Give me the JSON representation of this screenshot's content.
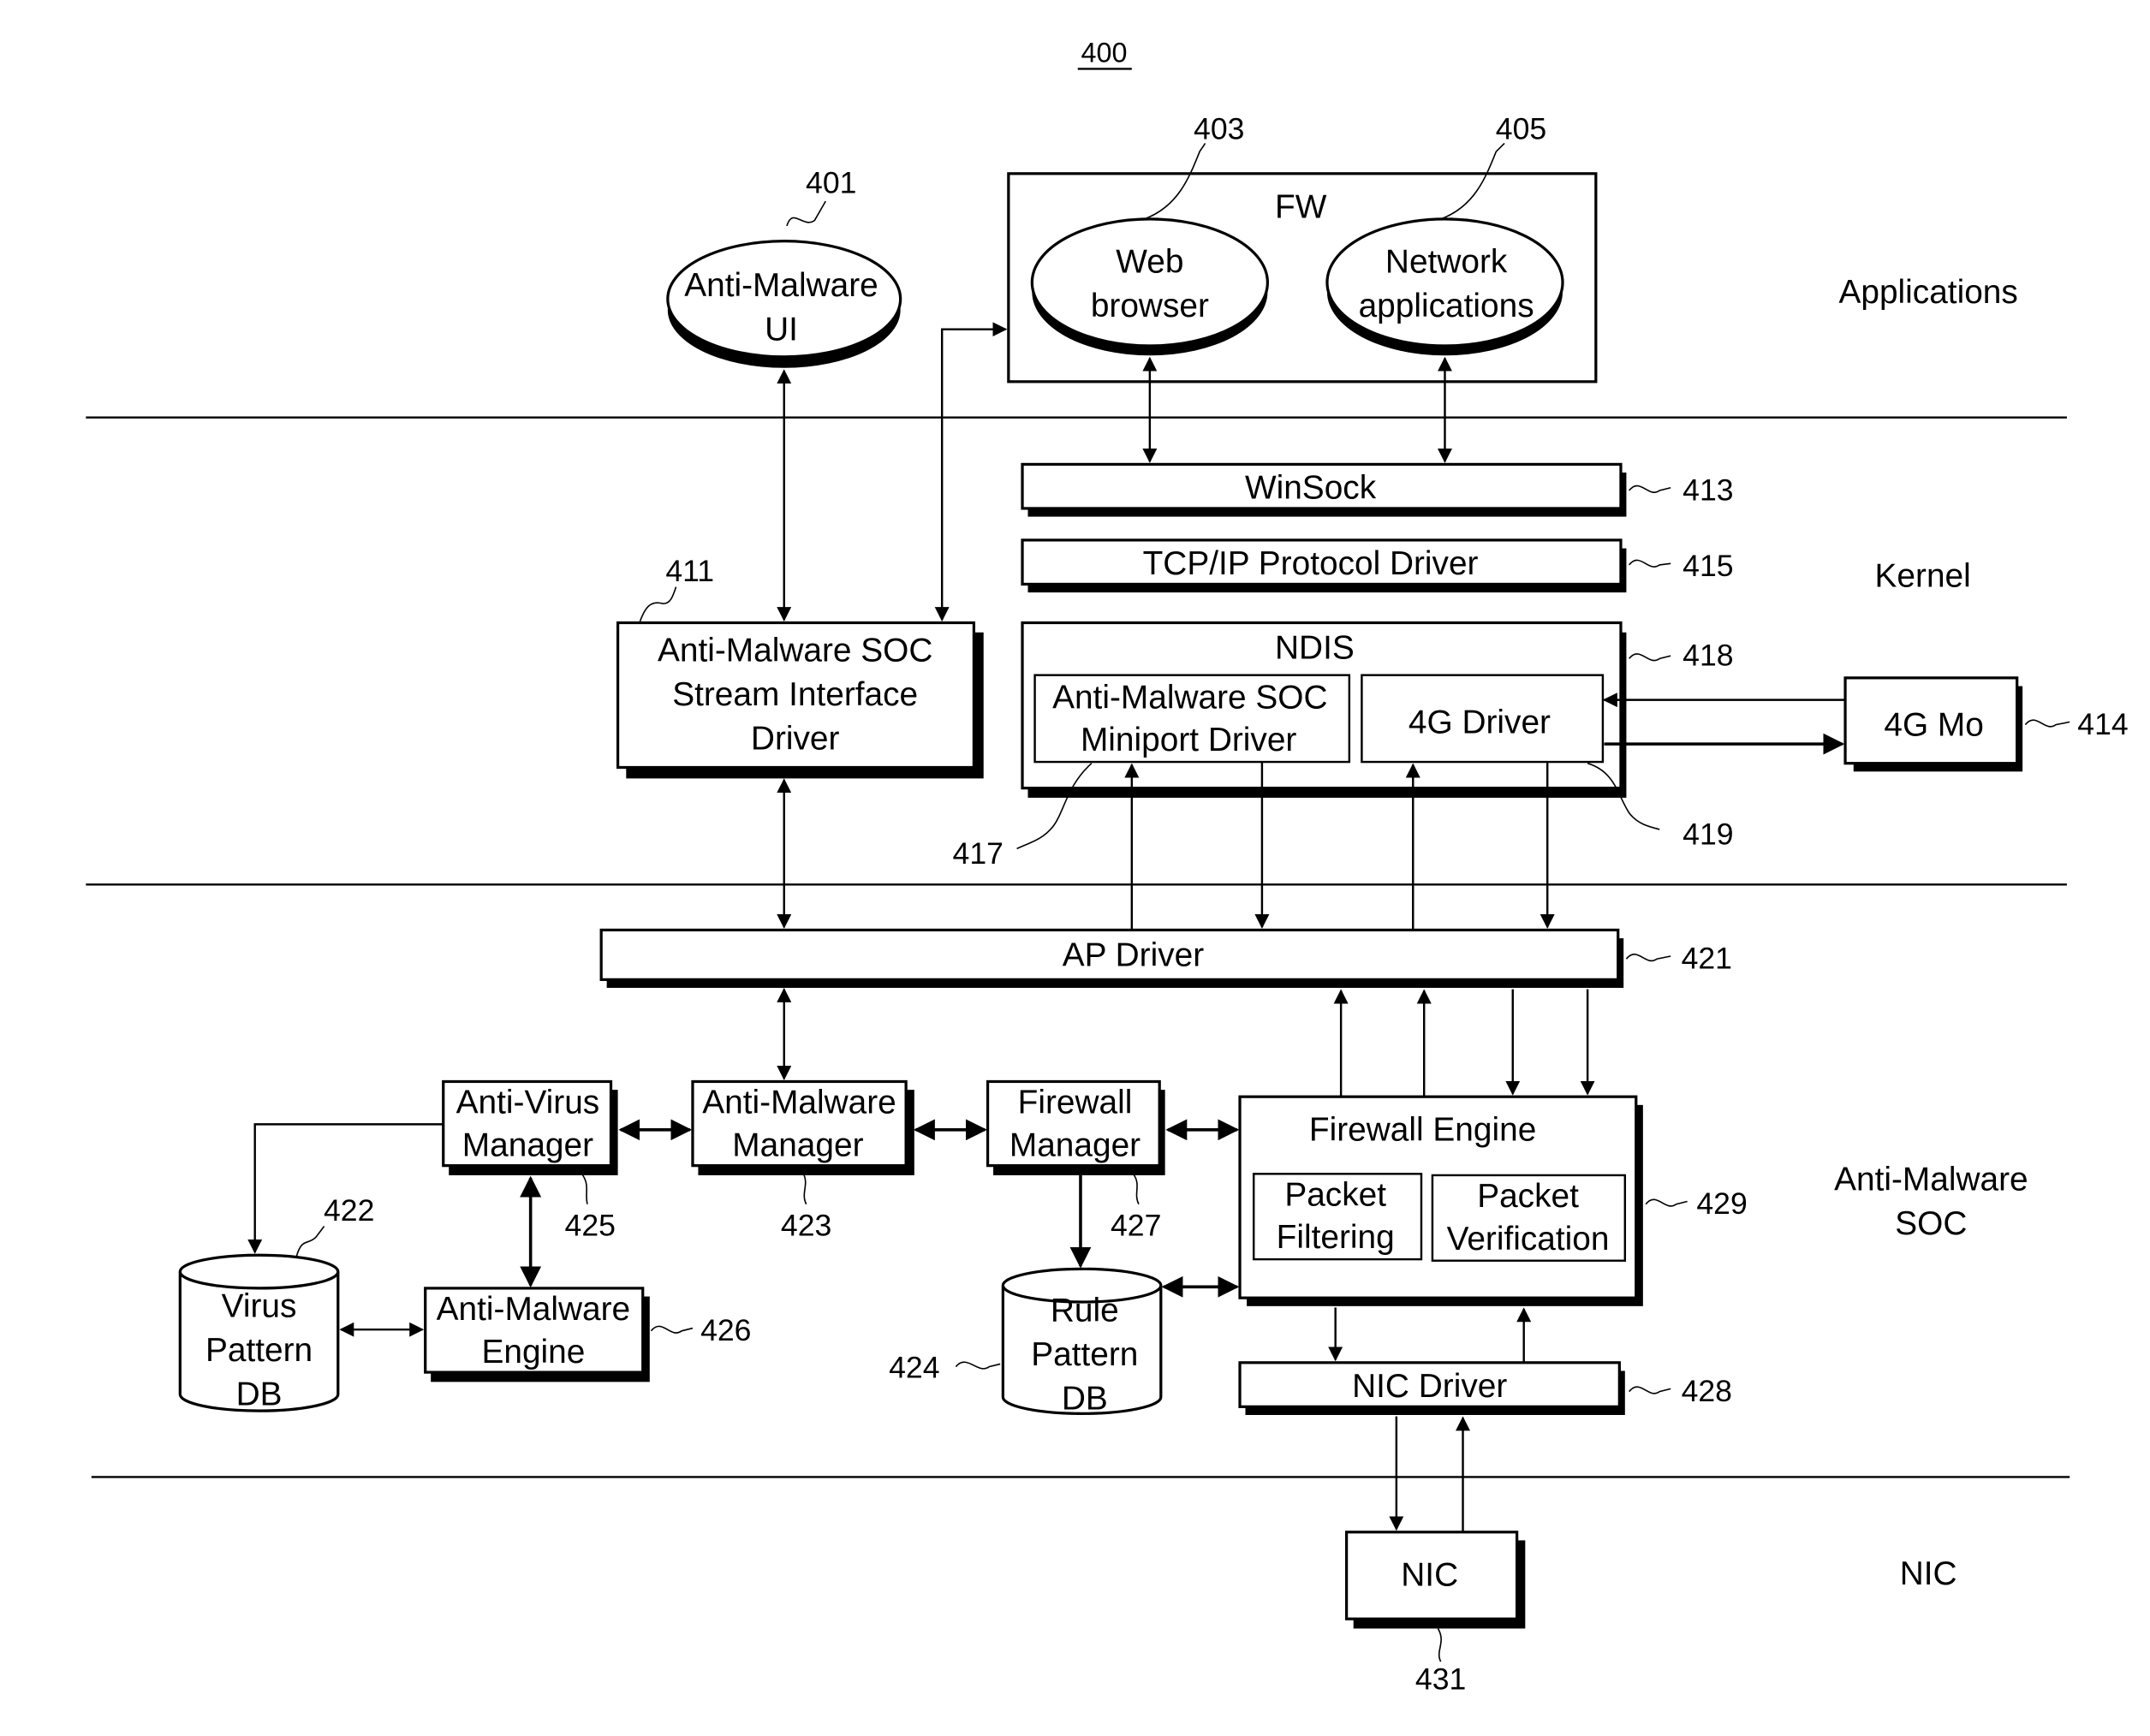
{
  "figure_number": "400",
  "layers": {
    "applications": "Applications",
    "kernel": "Kernel",
    "soc": [
      "Anti-Malware",
      "SOC"
    ],
    "nic": "NIC"
  },
  "components": {
    "anti_malware_ui": {
      "lines": [
        "Anti-Malware",
        "UI"
      ],
      "ref": "401"
    },
    "fw_group": {
      "title": "FW"
    },
    "web_browser": {
      "lines": [
        "Web",
        "browser"
      ],
      "ref": "403"
    },
    "network_apps": {
      "lines": [
        "Network",
        "applications"
      ],
      "ref": "405"
    },
    "stream_interface_driver": {
      "lines": [
        "Anti-Malware SOC",
        "Stream Interface",
        "Driver"
      ],
      "ref": "411"
    },
    "winsock": {
      "label": "WinSock",
      "ref": "413"
    },
    "tcpip": {
      "label": "TCP/IP Protocol Driver",
      "ref": "415"
    },
    "ndis": {
      "title": "NDIS",
      "ref": "418"
    },
    "miniport_driver": {
      "lines": [
        "Anti-Malware SOC",
        "Miniport Driver"
      ],
      "ref": "417"
    },
    "fourg_driver": {
      "label": "4G Driver",
      "ref": "419"
    },
    "fourg_module": {
      "label": "4G Mo",
      "ref": "414"
    },
    "ap_driver": {
      "label": "AP Driver",
      "ref": "421"
    },
    "anti_virus_manager": {
      "lines": [
        "Anti-Virus",
        "Manager"
      ],
      "ref": "425"
    },
    "anti_malware_manager": {
      "lines": [
        "Anti-Malware",
        "Manager"
      ],
      "ref": "423"
    },
    "firewall_manager": {
      "lines": [
        "Firewall",
        "Manager"
      ],
      "ref": "427"
    },
    "virus_pattern_db": {
      "lines": [
        "Virus",
        "Pattern",
        "DB"
      ],
      "ref": "422"
    },
    "anti_malware_engine": {
      "lines": [
        "Anti-Malware",
        "Engine"
      ],
      "ref": "426"
    },
    "rule_pattern_db": {
      "lines": [
        "Rule",
        "Pattern",
        "DB"
      ],
      "ref": "424"
    },
    "firewall_engine": {
      "title": "Firewall Engine",
      "ref": "429"
    },
    "packet_filtering": {
      "lines": [
        "Packet",
        "Filtering"
      ]
    },
    "packet_verification": {
      "lines": [
        "Packet",
        "Verification"
      ]
    },
    "nic_driver": {
      "label": "NIC Driver",
      "ref": "428"
    },
    "nic": {
      "label": "NIC",
      "ref": "431"
    }
  }
}
